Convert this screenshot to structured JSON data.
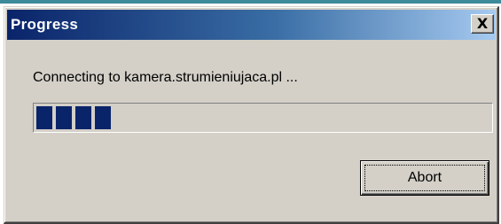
{
  "window": {
    "title": "Progress",
    "close_glyph": "X"
  },
  "message": "Connecting to kamera.strumieniujaca.pl ...",
  "progress": {
    "filled_blocks": 4,
    "fraction": 0.2,
    "bar_color": "#0a246a"
  },
  "buttons": {
    "abort_label": "Abort"
  },
  "colors": {
    "titlebar_start": "#0a246a",
    "titlebar_end": "#a6caf0",
    "face": "#d4d0c8"
  }
}
